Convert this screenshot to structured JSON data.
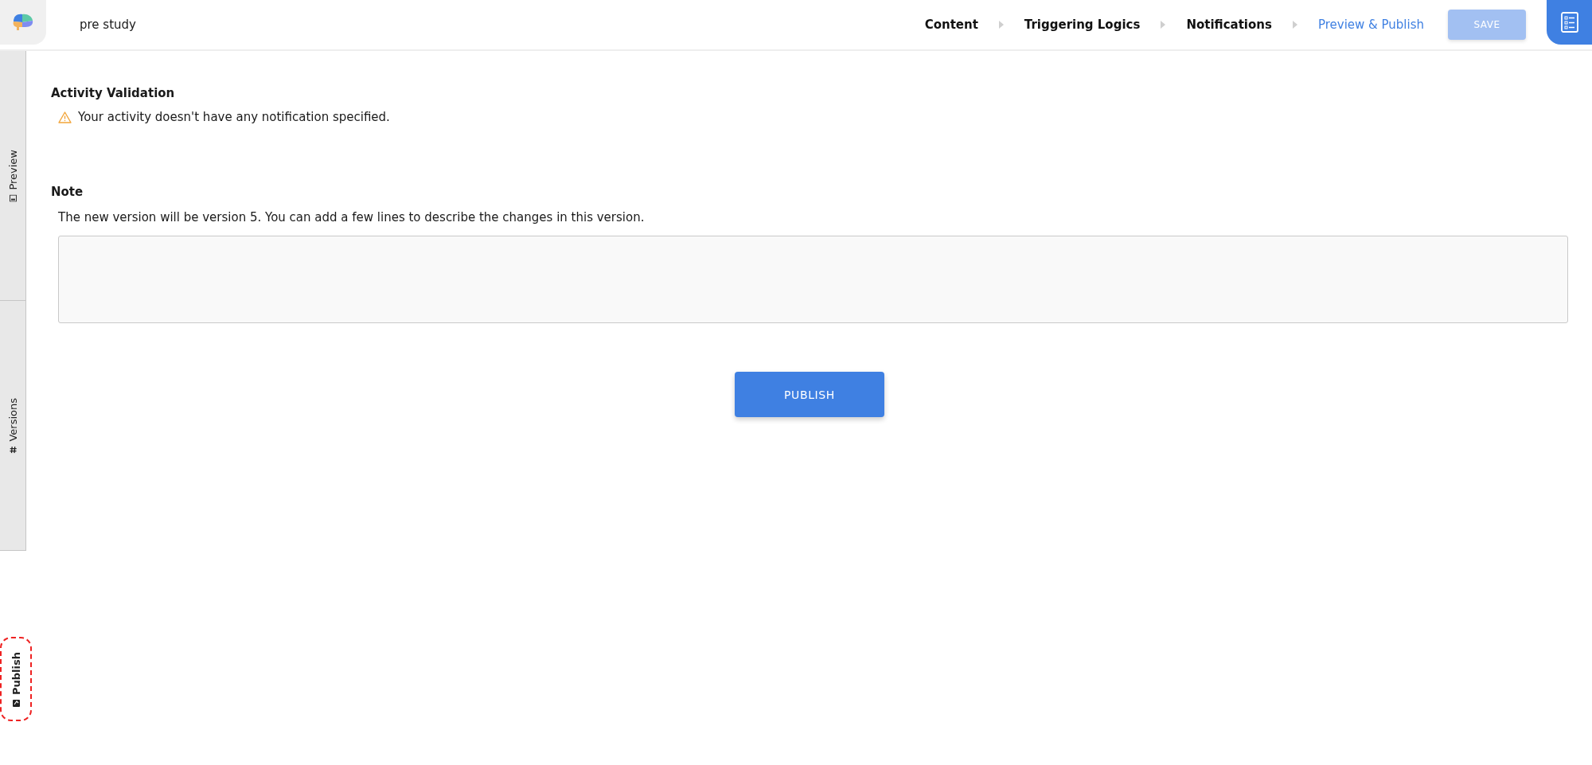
{
  "header": {
    "title": "pre study",
    "steps": [
      {
        "label": "Content",
        "selected": false
      },
      {
        "label": "Triggering Logics",
        "selected": false
      },
      {
        "label": "Notifications",
        "selected": false
      },
      {
        "label": "Preview & Publish",
        "selected": true
      }
    ],
    "save_button": {
      "label": "SAVE",
      "disabled": true
    }
  },
  "sidebar": {
    "tabs": [
      {
        "label": "Preview",
        "kind": "preview",
        "selected": false
      },
      {
        "label": "Versions",
        "kind": "versions",
        "selected": false
      },
      {
        "label": "Publish",
        "kind": "publish",
        "selected": true
      }
    ]
  },
  "validation": {
    "heading": "Activity Validation",
    "warnings": [
      "Your activity doesn't have any notification specified."
    ]
  },
  "note": {
    "heading": "Note",
    "description": "The new version will be version 5. You can add a few lines to describe the changes in this version."
  },
  "publish_button": {
    "label": "PUBLISH"
  }
}
